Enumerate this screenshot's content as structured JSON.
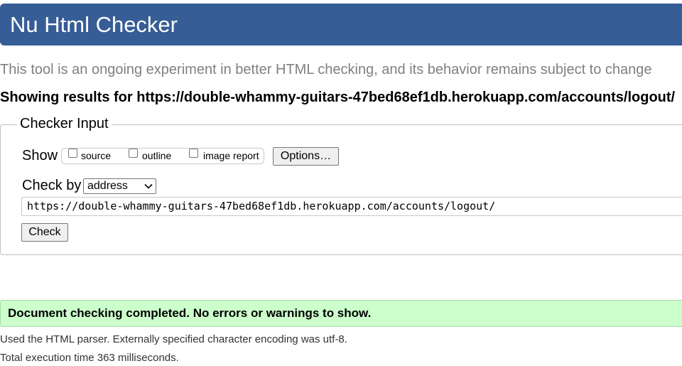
{
  "header": {
    "title": "Nu Html Checker",
    "bg_color": "#365d95"
  },
  "tagline": "This tool is an ongoing experiment in better HTML checking, and its behavior remains subject to change",
  "results_heading": "Showing results for https://double-whammy-guitars-47bed68ef1db.herokuapp.com/accounts/logout/",
  "checker_input": {
    "legend": "Checker Input",
    "show_label": "Show",
    "options": [
      {
        "label": "source",
        "checked": false
      },
      {
        "label": "outline",
        "checked": false
      },
      {
        "label": "image report",
        "checked": false
      }
    ],
    "options_button": "Options…",
    "check_by_label": "Check by",
    "check_by_value": "address",
    "url_value": "https://double-whammy-guitars-47bed68ef1db.herokuapp.com/accounts/logout/",
    "check_button": "Check"
  },
  "result": {
    "message": "Document checking completed. No errors or warnings to show.",
    "color": "#ccffcc"
  },
  "details": {
    "parser_line": "Used the HTML parser. Externally specified character encoding was utf-8.",
    "time_line": "Total execution time 363 milliseconds."
  }
}
